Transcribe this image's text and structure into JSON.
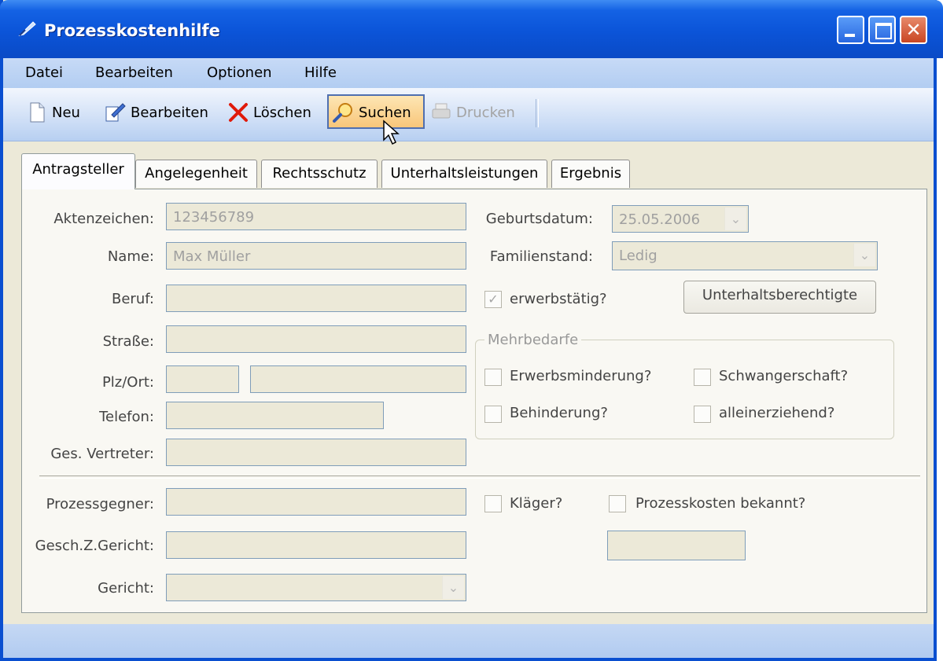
{
  "window": {
    "title": "Prozesskostenhilfe",
    "icons": {
      "app": "feather-icon",
      "minimize": "minimize-icon",
      "maximize": "maximize-icon",
      "close": "close-icon"
    }
  },
  "menu": [
    "Datei",
    "Bearbeiten",
    "Optionen",
    "Hilfe"
  ],
  "toolbar": {
    "new_label": "Neu",
    "edit_label": "Bearbeiten",
    "delete_label": "Löschen",
    "search_label": "Suchen",
    "print_label": "Drucken"
  },
  "tabs": [
    "Antragsteller",
    "Angelegenheit",
    "Rechtsschutz",
    "Unterhaltsleistungen",
    "Ergebnis"
  ],
  "form": {
    "aktenzeichen_label": "Aktenzeichen:",
    "aktenzeichen_value": "123456789",
    "name_label": "Name:",
    "name_value": "Max Müller",
    "beruf_label": "Beruf:",
    "strasse_label": "Straße:",
    "plzort_label": "Plz/Ort:",
    "telefon_label": "Telefon:",
    "vertreter_label": "Ges. Vertreter:",
    "geburtsdatum_label": "Geburtsdatum:",
    "geburtsdatum_value": "25.05.2006",
    "familienstand_label": "Familienstand:",
    "familienstand_value": "Ledig",
    "erwerbstaetig_label": "erwerbstätig?",
    "unterhalt_button": "Unterhaltsberechtigte",
    "mehrbedarfe_title": "Mehrbedarfe",
    "erwerbsminderung_label": "Erwerbsminderung?",
    "schwangerschaft_label": "Schwangerschaft?",
    "behinderung_label": "Behinderung?",
    "alleinerziehend_label": "alleinerziehend?",
    "prozessgegner_label": "Prozessgegner:",
    "geschz_label": "Gesch.Z.Gericht:",
    "gericht_label": "Gericht:",
    "klaeger_label": "Kläger?",
    "prozesskosten_label": "Prozesskosten bekannt?"
  }
}
